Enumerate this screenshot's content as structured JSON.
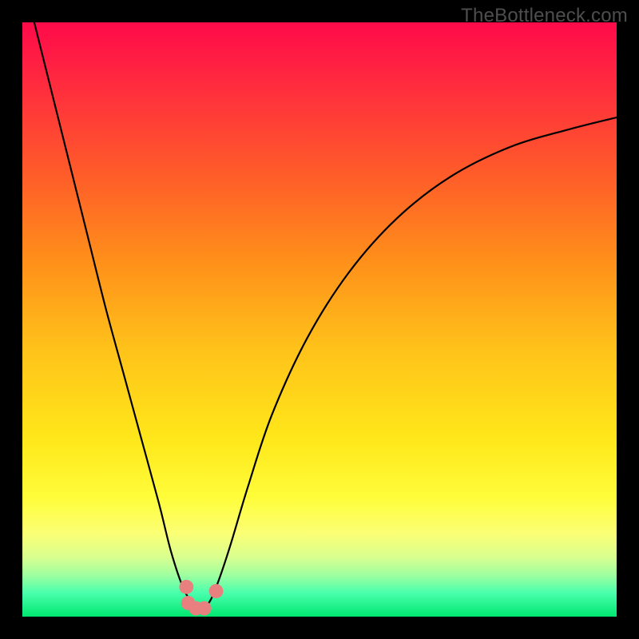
{
  "watermark": "TheBottleneck.com",
  "chart_data": {
    "type": "line",
    "title": "",
    "xlabel": "",
    "ylabel": "",
    "xlim": [
      0,
      100
    ],
    "ylim": [
      0,
      100
    ],
    "grid": false,
    "series": [
      {
        "name": "bottleneck-curve",
        "x": [
          2,
          5,
          8,
          11,
          14,
          17,
          20,
          23,
          25,
          27,
          28.5,
          30,
          31.5,
          33,
          35,
          38,
          42,
          48,
          55,
          63,
          72,
          82,
          92,
          100
        ],
        "values": [
          100,
          88,
          76,
          64,
          52,
          41,
          30,
          19,
          11,
          5,
          2.5,
          1.5,
          2.5,
          6,
          12,
          22,
          34,
          47,
          58,
          67,
          74,
          79,
          82,
          84
        ]
      }
    ],
    "gradient_stops": [
      {
        "offset": 0.0,
        "color": "#ff0a4a"
      },
      {
        "offset": 0.1,
        "color": "#ff2a3f"
      },
      {
        "offset": 0.25,
        "color": "#ff5a2a"
      },
      {
        "offset": 0.4,
        "color": "#ff8f1a"
      },
      {
        "offset": 0.55,
        "color": "#ffc21a"
      },
      {
        "offset": 0.7,
        "color": "#ffe71a"
      },
      {
        "offset": 0.8,
        "color": "#fffd3a"
      },
      {
        "offset": 0.86,
        "color": "#fbff75"
      },
      {
        "offset": 0.9,
        "color": "#d9ff8f"
      },
      {
        "offset": 0.93,
        "color": "#9fffa0"
      },
      {
        "offset": 0.96,
        "color": "#4affad"
      },
      {
        "offset": 1.0,
        "color": "#00e770"
      }
    ],
    "markers": [
      {
        "name": "left-dot-upper",
        "x": 27.6,
        "y": 5.0
      },
      {
        "name": "left-dot-lower",
        "x": 27.9,
        "y": 2.3
      },
      {
        "name": "bottom-dot-1",
        "x": 29.2,
        "y": 1.4
      },
      {
        "name": "bottom-dot-2",
        "x": 30.6,
        "y": 1.4
      },
      {
        "name": "right-dot",
        "x": 32.6,
        "y": 4.3
      }
    ],
    "marker_style": {
      "radius_pct": 1.2,
      "fill": "#e98080"
    }
  }
}
